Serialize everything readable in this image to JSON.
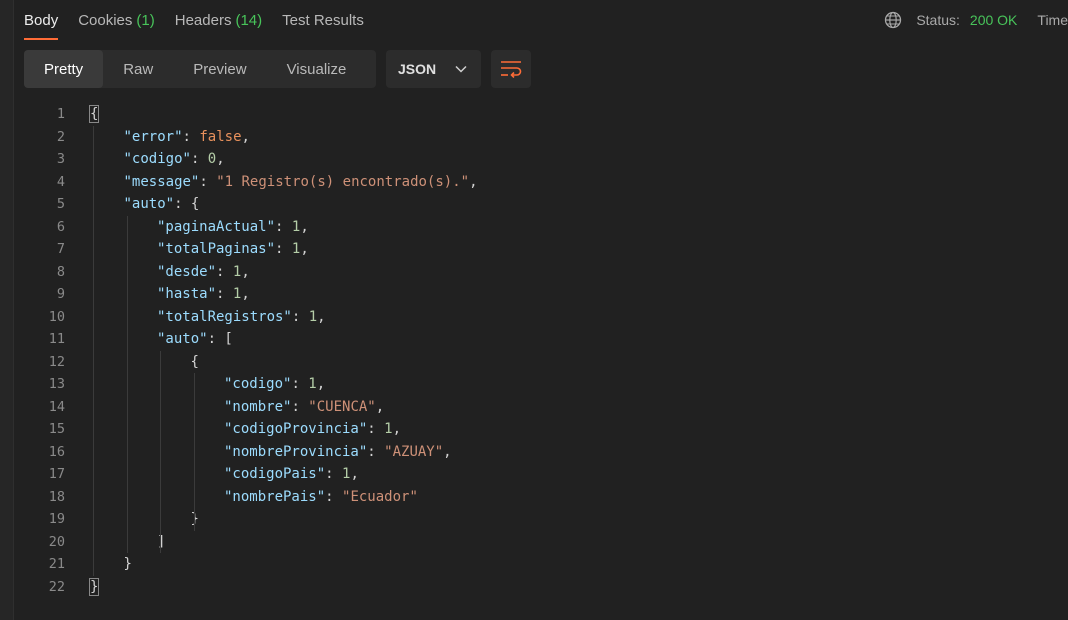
{
  "tabs": [
    {
      "label": "Body",
      "count": ""
    },
    {
      "label": "Cookies",
      "count": "(1)"
    },
    {
      "label": "Headers",
      "count": "(14)"
    },
    {
      "label": "Test Results",
      "count": ""
    }
  ],
  "status": {
    "label": "Status:",
    "value": "200 OK",
    "time_label": "Time"
  },
  "view_modes": [
    "Pretty",
    "Raw",
    "Preview",
    "Visualize"
  ],
  "format": {
    "selected": "JSON"
  },
  "code_lines": [
    {
      "n": "1",
      "indent": 0,
      "t": [
        [
          "p",
          "{"
        ]
      ]
    },
    {
      "n": "2",
      "indent": 1,
      "t": [
        [
          "k",
          "\"error\""
        ],
        [
          "p",
          ": "
        ],
        [
          "b",
          "false"
        ],
        [
          "p",
          ","
        ]
      ]
    },
    {
      "n": "3",
      "indent": 1,
      "t": [
        [
          "k",
          "\"codigo\""
        ],
        [
          "p",
          ": "
        ],
        [
          "n",
          "0"
        ],
        [
          "p",
          ","
        ]
      ]
    },
    {
      "n": "4",
      "indent": 1,
      "t": [
        [
          "k",
          "\"message\""
        ],
        [
          "p",
          ": "
        ],
        [
          "s",
          "\"1 Registro(s) encontrado(s).\""
        ],
        [
          "p",
          ","
        ]
      ]
    },
    {
      "n": "5",
      "indent": 1,
      "t": [
        [
          "k",
          "\"auto\""
        ],
        [
          "p",
          ": {"
        ]
      ]
    },
    {
      "n": "6",
      "indent": 2,
      "t": [
        [
          "k",
          "\"paginaActual\""
        ],
        [
          "p",
          ": "
        ],
        [
          "n",
          "1"
        ],
        [
          "p",
          ","
        ]
      ]
    },
    {
      "n": "7",
      "indent": 2,
      "t": [
        [
          "k",
          "\"totalPaginas\""
        ],
        [
          "p",
          ": "
        ],
        [
          "n",
          "1"
        ],
        [
          "p",
          ","
        ]
      ]
    },
    {
      "n": "8",
      "indent": 2,
      "t": [
        [
          "k",
          "\"desde\""
        ],
        [
          "p",
          ": "
        ],
        [
          "n",
          "1"
        ],
        [
          "p",
          ","
        ]
      ]
    },
    {
      "n": "9",
      "indent": 2,
      "t": [
        [
          "k",
          "\"hasta\""
        ],
        [
          "p",
          ": "
        ],
        [
          "n",
          "1"
        ],
        [
          "p",
          ","
        ]
      ]
    },
    {
      "n": "10",
      "indent": 2,
      "t": [
        [
          "k",
          "\"totalRegistros\""
        ],
        [
          "p",
          ": "
        ],
        [
          "n",
          "1"
        ],
        [
          "p",
          ","
        ]
      ]
    },
    {
      "n": "11",
      "indent": 2,
      "t": [
        [
          "k",
          "\"auto\""
        ],
        [
          "p",
          ": ["
        ]
      ]
    },
    {
      "n": "12",
      "indent": 3,
      "t": [
        [
          "p",
          "{"
        ]
      ]
    },
    {
      "n": "13",
      "indent": 4,
      "t": [
        [
          "k",
          "\"codigo\""
        ],
        [
          "p",
          ": "
        ],
        [
          "n",
          "1"
        ],
        [
          "p",
          ","
        ]
      ]
    },
    {
      "n": "14",
      "indent": 4,
      "t": [
        [
          "k",
          "\"nombre\""
        ],
        [
          "p",
          ": "
        ],
        [
          "s",
          "\"CUENCA\""
        ],
        [
          "p",
          ","
        ]
      ]
    },
    {
      "n": "15",
      "indent": 4,
      "t": [
        [
          "k",
          "\"codigoProvincia\""
        ],
        [
          "p",
          ": "
        ],
        [
          "n",
          "1"
        ],
        [
          "p",
          ","
        ]
      ]
    },
    {
      "n": "16",
      "indent": 4,
      "t": [
        [
          "k",
          "\"nombreProvincia\""
        ],
        [
          "p",
          ": "
        ],
        [
          "s",
          "\"AZUAY\""
        ],
        [
          "p",
          ","
        ]
      ]
    },
    {
      "n": "17",
      "indent": 4,
      "t": [
        [
          "k",
          "\"codigoPais\""
        ],
        [
          "p",
          ": "
        ],
        [
          "n",
          "1"
        ],
        [
          "p",
          ","
        ]
      ]
    },
    {
      "n": "18",
      "indent": 4,
      "t": [
        [
          "k",
          "\"nombrePais\""
        ],
        [
          "p",
          ": "
        ],
        [
          "s",
          "\"Ecuador\""
        ]
      ]
    },
    {
      "n": "19",
      "indent": 3,
      "t": [
        [
          "p",
          "}"
        ]
      ]
    },
    {
      "n": "20",
      "indent": 2,
      "t": [
        [
          "p",
          "]"
        ]
      ]
    },
    {
      "n": "21",
      "indent": 1,
      "t": [
        [
          "p",
          "}"
        ]
      ]
    },
    {
      "n": "22",
      "indent": 0,
      "t": [
        [
          "p",
          "}"
        ]
      ]
    }
  ]
}
